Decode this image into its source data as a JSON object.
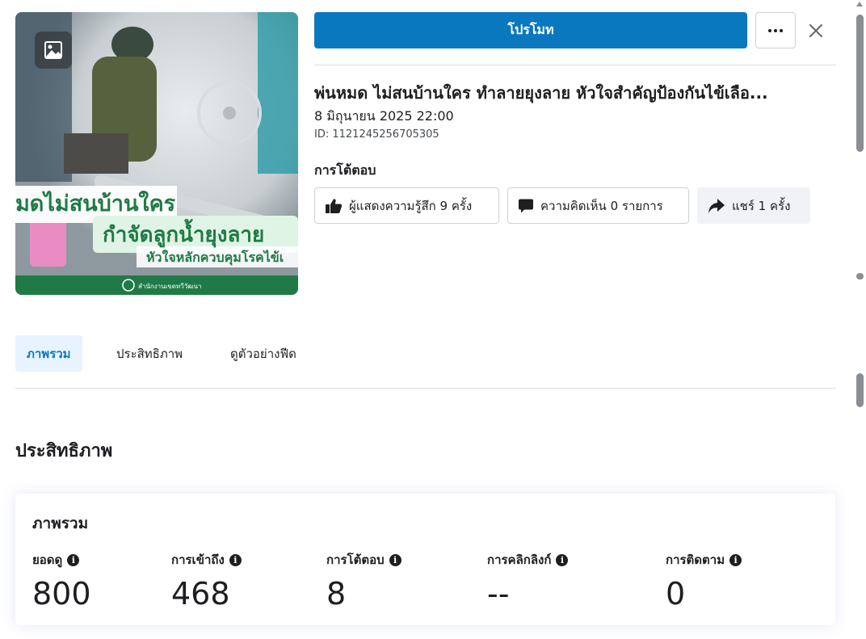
{
  "header": {
    "promote_label": "โปรโมท",
    "more_label": "More options",
    "close_label": "Close"
  },
  "thumbnail": {
    "overlay_text_line1": "มดไม่สนบ้านใคร",
    "overlay_text_line2": "กำจัดลูกน้ำยุงลาย",
    "overlay_text_line3": "หัวใจหลักควบคุมโรคไข้เ",
    "footer_text": "สำนักงานเขตทวีวัฒนา"
  },
  "post": {
    "title": "พ่นหมด ไม่สนบ้านใคร ทำลายยุงลาย หัวใจสำคัญป้องกันไข้เลือ...",
    "date": "8 มิถุนายน 2025 22:00",
    "id": "ID: 1121245256705305"
  },
  "engagement": {
    "label": "การโต้ตอบ",
    "reactions": "ผู้แสดงความรู้สึก 9 ครั้ง",
    "comments": "ความคิดเห็น 0 รายการ",
    "shares": "แชร์ 1 ครั้ง"
  },
  "tabs": [
    {
      "label": "ภาพรวม",
      "active": true
    },
    {
      "label": "ประสิทธิภาพ",
      "active": false
    },
    {
      "label": "ดูตัวอย่างฟีด",
      "active": false
    }
  ],
  "performance": {
    "section_title": "ประสิทธิภาพ",
    "card_title": "ภาพรวม",
    "metrics": [
      {
        "label": "ยอดดู",
        "value": "800"
      },
      {
        "label": "การเข้าถึง",
        "value": "468"
      },
      {
        "label": "การโต้ตอบ",
        "value": "8"
      },
      {
        "label": "การคลิกลิงก์",
        "value": "--"
      },
      {
        "label": "การติดตาม",
        "value": "0"
      }
    ]
  },
  "colors": {
    "accent": "#0a78be",
    "tab_active_bg": "#e7f3ff",
    "thumbnail_footer": "#1f7a46"
  }
}
